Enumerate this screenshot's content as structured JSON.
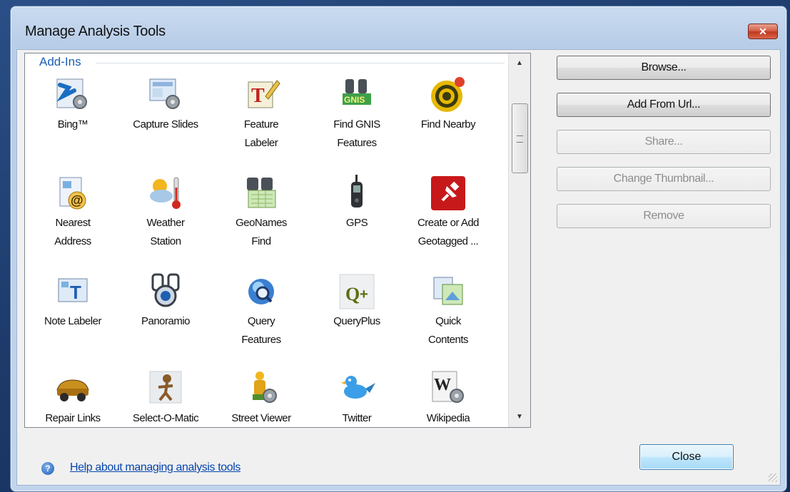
{
  "window": {
    "title": "Manage Analysis Tools",
    "close_glyph": "✕"
  },
  "group": {
    "label": "Add-Ins"
  },
  "tools": [
    {
      "label_1": "Bing™",
      "label_2": "",
      "icon": "bing-icon"
    },
    {
      "label_1": "Capture Slides",
      "label_2": "",
      "icon": "capture-slides-icon"
    },
    {
      "label_1": "Feature",
      "label_2": "Labeler",
      "icon": "feature-labeler-icon"
    },
    {
      "label_1": "Find GNIS",
      "label_2": "Features",
      "icon": "gnis-binoculars-icon"
    },
    {
      "label_1": "Find Nearby",
      "label_2": "",
      "icon": "target-icon"
    },
    {
      "label_1": "Nearest",
      "label_2": "Address",
      "icon": "address-at-icon"
    },
    {
      "label_1": "Weather",
      "label_2": "Station",
      "icon": "weather-icon"
    },
    {
      "label_1": "GeoNames",
      "label_2": "Find",
      "icon": "geonames-icon"
    },
    {
      "label_1": "GPS",
      "label_2": "",
      "icon": "gps-device-icon"
    },
    {
      "label_1": "Create or Add",
      "label_2": "Geotagged ...",
      "icon": "pushpin-icon"
    },
    {
      "label_1": "Note Labeler",
      "label_2": "",
      "icon": "note-labeler-icon"
    },
    {
      "label_1": "Panoramio",
      "label_2": "",
      "icon": "panoramio-icon"
    },
    {
      "label_1": "Query",
      "label_2": "Features",
      "icon": "query-globe-icon"
    },
    {
      "label_1": "QueryPlus",
      "label_2": "",
      "icon": "queryplus-icon"
    },
    {
      "label_1": "Quick",
      "label_2": "Contents",
      "icon": "quick-contents-icon"
    },
    {
      "label_1": "Repair Links",
      "label_2": "",
      "icon": "repair-car-icon"
    },
    {
      "label_1": "Select-O-Matic",
      "label_2": "",
      "icon": "select-o-matic-icon"
    },
    {
      "label_1": "Street Viewer",
      "label_2": "",
      "icon": "street-viewer-icon"
    },
    {
      "label_1": "Twitter",
      "label_2": "",
      "icon": "twitter-bird-icon"
    },
    {
      "label_1": "Wikipedia",
      "label_2": "",
      "icon": "wikipedia-icon"
    }
  ],
  "buttons": {
    "browse": "Browse...",
    "add_from_url": "Add From Url...",
    "share": "Share...",
    "change_thumbnail": "Change Thumbnail...",
    "remove": "Remove",
    "close": "Close"
  },
  "footer": {
    "help_link": "Help about managing analysis tools",
    "help_glyph": "?"
  },
  "scrollbar": {
    "up_glyph": "▲",
    "down_glyph": "▼"
  },
  "colors": {
    "link": "#0645ad",
    "group_label": "#1a5fb4",
    "close_red": "#c0391f"
  }
}
